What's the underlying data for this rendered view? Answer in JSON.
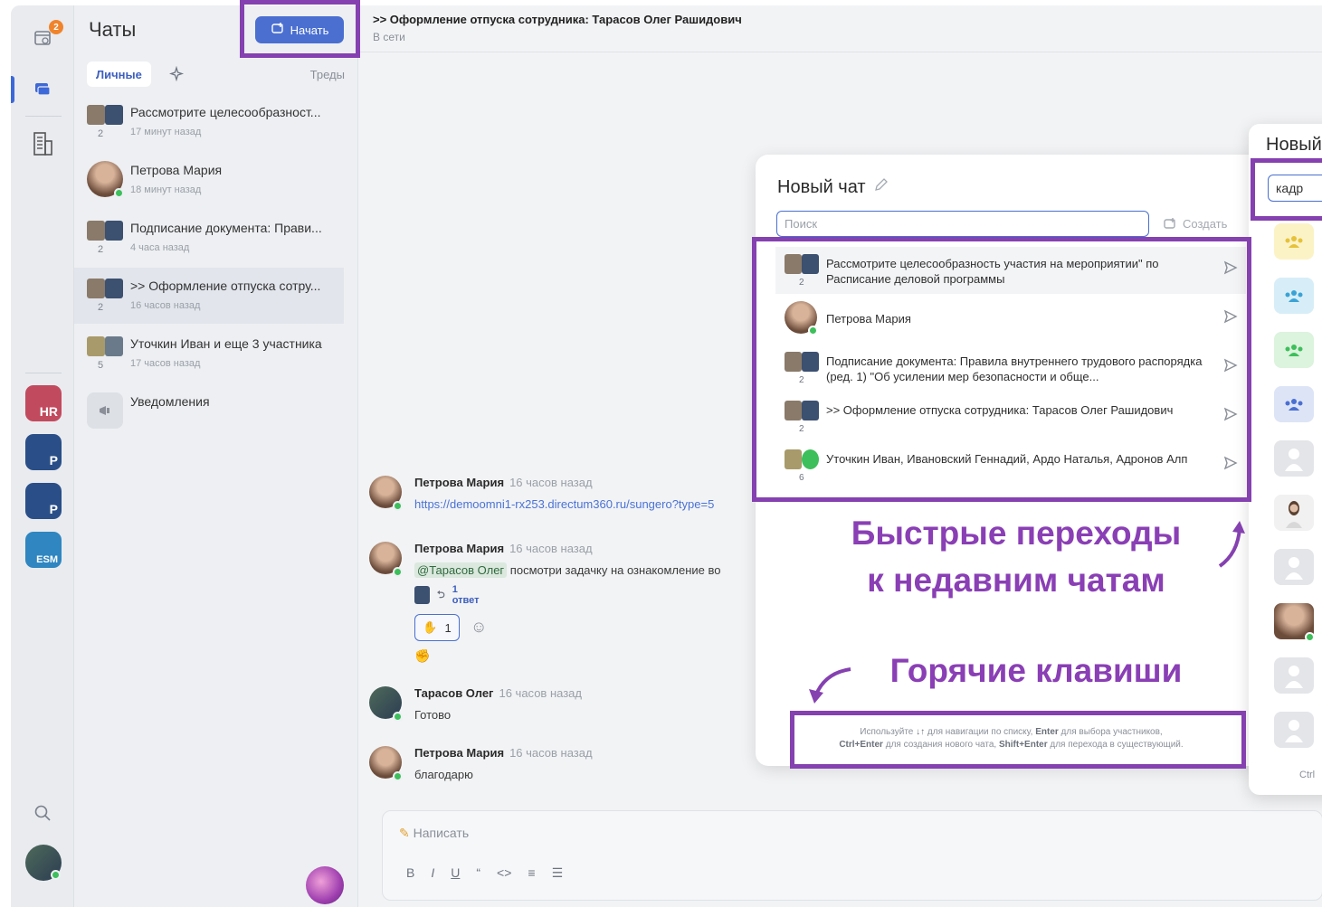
{
  "rail": {
    "calendar_badge": "2",
    "apps": [
      {
        "label": "HR",
        "color": "#c24a5e"
      },
      {
        "label": "P",
        "color": "#2a4f88"
      },
      {
        "label": "P",
        "color": "#2a4f88"
      },
      {
        "label": "ESM",
        "color": "#2f86c0"
      }
    ]
  },
  "chatlist": {
    "title": "Чаты",
    "start_label": "Начать",
    "tab_personal": "Личные",
    "tab_threads": "Треды",
    "items": [
      {
        "name": "Рассмотрите целесообразност...",
        "time": "17 минут назад",
        "count": "2"
      },
      {
        "name": "Петрова Мария",
        "time": "18 минут назад",
        "count": ""
      },
      {
        "name": "Подписание документа: Прави...",
        "time": "4 часа назад",
        "count": "2"
      },
      {
        "name": ">> Оформление отпуска сотру...",
        "time": "16 часов назад",
        "count": "2"
      },
      {
        "name": "Уточкин Иван и еще 3 участника",
        "time": "17 часов назад",
        "count": "5"
      },
      {
        "name": "Уведомления",
        "time": "",
        "count": ""
      }
    ]
  },
  "main": {
    "title": ">> Оформление отпуска сотрудника: Тарасов Олег Рашидович",
    "status": "В сети",
    "messages": [
      {
        "author": "Петрова Мария",
        "time": "16 часов назад",
        "text": "https://demoomni1-rx253.directum360.ru/sungero?type=5"
      },
      {
        "author": "Петрова Мария",
        "time": "16 часов назад",
        "mention": "@Тарасов Олег",
        "text": "посмотри задачку на ознакомление во"
      },
      {
        "author": "Тарасов Олег",
        "time": "16 часов назад",
        "text": "Готово"
      },
      {
        "author": "Петрова Мария",
        "time": "16 часов назад",
        "text": "благодарю"
      }
    ],
    "reply_label": "1 ответ",
    "reaction_count": "1",
    "compose_placeholder": "Написать",
    "format_buttons": [
      "B",
      "I",
      "U",
      "“",
      "<>",
      "≡",
      "☰"
    ]
  },
  "new_chat": {
    "title": "Новый чат",
    "search_placeholder": "Поиск",
    "create_label": "Создать",
    "items": [
      {
        "name": "Рассмотрите целесообразность участия на мероприятии\" по Расписание деловой программы",
        "count": "2"
      },
      {
        "name": "Петрова Мария",
        "count": ""
      },
      {
        "name": "Подписание документа: Правила внутреннего трудового распорядка (ред. 1) \"Об усилении мер безопасности и обще...",
        "count": "2"
      },
      {
        "name": ">> Оформление отпуска сотрудника: Тарасов Олег Рашидович",
        "count": "2"
      },
      {
        "name": "Уточкин Иван, Ивановский Геннадий, Ардо Наталья, Адронов Алп",
        "count": "6"
      }
    ],
    "hint_line1_a": "Используйте ",
    "hint_keys1": "↓↑",
    "hint_line1_b": " для навигации по списку, ",
    "hint_key2": "Enter",
    "hint_line1_c": " для выбора участников,",
    "hint_key3": "Ctrl+Enter",
    "hint_line2_a": " для создания нового чата, ",
    "hint_key4": "Shift+Enter",
    "hint_line2_b": " для перехода в существующий."
  },
  "new_chat_2": {
    "title": "Новый",
    "search_value": "кадр",
    "footer": "Ctrl"
  },
  "annotations": {
    "quick_line1": "Быстрые переходы",
    "quick_line2": "к недавним чатам",
    "hotkeys": "Горячие клавиши"
  },
  "colors": {
    "accent": "#4a6fd1",
    "annotation": "#8541b0",
    "online": "#3dbf5b"
  }
}
